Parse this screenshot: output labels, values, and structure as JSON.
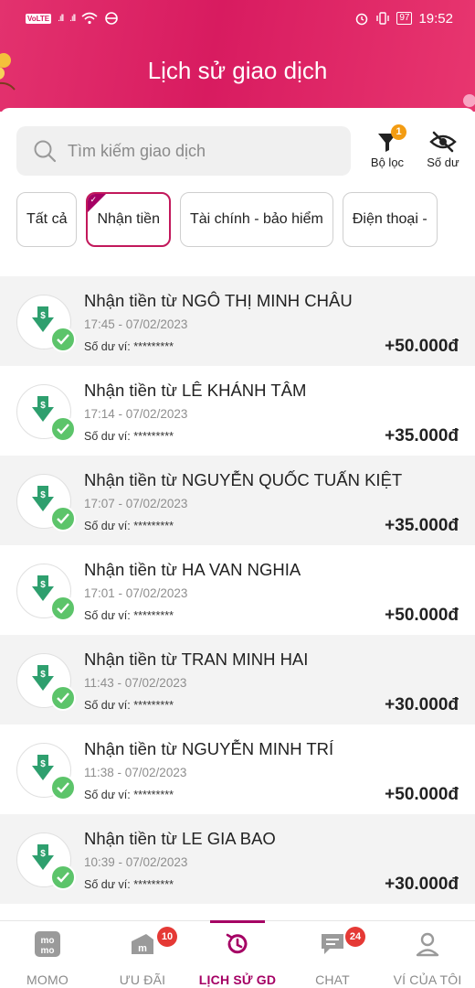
{
  "status_bar": {
    "left": "VoLTE",
    "battery": "97",
    "time": "19:52"
  },
  "header": {
    "title": "Lịch sử giao dịch"
  },
  "search": {
    "placeholder": "Tìm kiếm giao dịch"
  },
  "tools": {
    "filter_label": "Bộ lọc",
    "filter_badge": "1",
    "balance_label": "Số dư"
  },
  "chips": [
    {
      "label": "Tất cả",
      "active": false
    },
    {
      "label": "Nhận tiền",
      "active": true
    },
    {
      "label": "Tài chính - bảo hiểm",
      "active": false
    },
    {
      "label": "Điện thoại -",
      "active": false
    }
  ],
  "transactions": [
    {
      "name": "Nhận tiền từ NGÔ THỊ MINH CHÂU",
      "time": "17:45 - 07/02/2023",
      "wallet": "Số dư ví: *********",
      "amount": "+50.000đ"
    },
    {
      "name": "Nhận tiền từ LÊ KHÁNH TÂM",
      "time": "17:14 - 07/02/2023",
      "wallet": "Số dư ví: *********",
      "amount": "+35.000đ"
    },
    {
      "name": "Nhận tiền từ NGUYỄN QUỐC TUẤN KIỆT",
      "time": "17:07 - 07/02/2023",
      "wallet": "Số dư ví: *********",
      "amount": "+35.000đ"
    },
    {
      "name": "Nhận tiền từ HA VAN NGHIA",
      "time": "17:01 - 07/02/2023",
      "wallet": "Số dư ví: *********",
      "amount": "+50.000đ"
    },
    {
      "name": "Nhận tiền từ TRAN MINH HAI",
      "time": "11:43 - 07/02/2023",
      "wallet": "Số dư ví: *********",
      "amount": "+30.000đ"
    },
    {
      "name": "Nhận tiền từ NGUYỄN MINH TRÍ",
      "time": "11:38 - 07/02/2023",
      "wallet": "Số dư ví: *********",
      "amount": "+50.000đ"
    },
    {
      "name": "Nhận tiền từ LE GIA BAO",
      "time": "10:39 - 07/02/2023",
      "wallet": "Số dư ví: *********",
      "amount": "+30.000đ"
    }
  ],
  "bottom_nav": [
    {
      "label": "MOMO",
      "icon": "momo-logo-icon",
      "badge": ""
    },
    {
      "label": "ƯU ĐÃI",
      "icon": "promo-icon",
      "badge": "10"
    },
    {
      "label": "LỊCH SỬ GD",
      "icon": "history-icon",
      "badge": ""
    },
    {
      "label": "CHAT",
      "icon": "chat-icon",
      "badge": "24"
    },
    {
      "label": "VÍ CỦA TÔI",
      "icon": "profile-icon",
      "badge": ""
    }
  ],
  "colors": {
    "brand": "#a50064",
    "header": "#d81b60",
    "success": "#5cc46a",
    "badge": "#e53935",
    "filter_badge": "#f39c12"
  }
}
